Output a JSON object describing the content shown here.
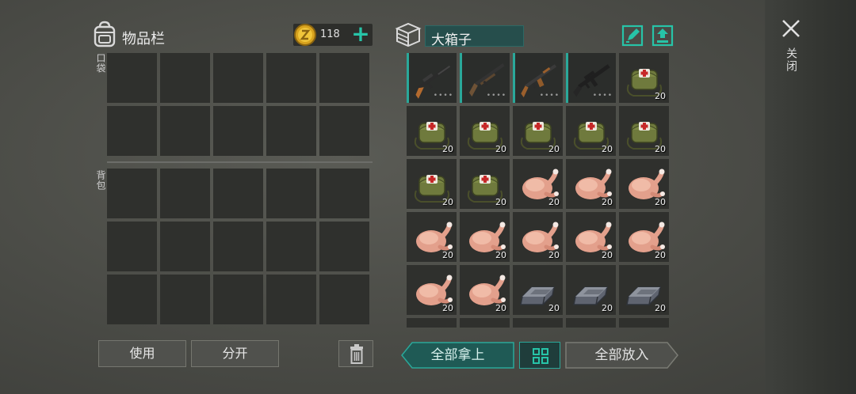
{
  "inventory": {
    "title": "物品栏",
    "coins": "118",
    "pocket_label": "口袋",
    "backpack_label": "背包",
    "icons": {
      "bag": "backpack-icon",
      "coin": "coin-icon",
      "add": "plus-icon",
      "trash": "trash-icon"
    }
  },
  "actions": {
    "use_label": "使用",
    "split_label": "分开"
  },
  "container": {
    "name": "大箱子",
    "take_all_label": "全部拿上",
    "put_all_label": "全部放入",
    "icons": {
      "box": "box-icon",
      "rename": "edit-icon",
      "sort": "sort-up-icon",
      "grid": "grid-icon"
    },
    "items": [
      {
        "type": "sniper-rifle",
        "weapon": true,
        "qty": ""
      },
      {
        "type": "shotgun",
        "weapon": true,
        "qty": ""
      },
      {
        "type": "ak-rifle",
        "weapon": true,
        "qty": ""
      },
      {
        "type": "m16-rifle",
        "weapon": true,
        "qty": ""
      },
      {
        "type": "medkit-bag",
        "weapon": false,
        "qty": "20"
      },
      {
        "type": "medkit-bag",
        "weapon": false,
        "qty": "20"
      },
      {
        "type": "medkit-bag",
        "weapon": false,
        "qty": "20"
      },
      {
        "type": "medkit-bag",
        "weapon": false,
        "qty": "20"
      },
      {
        "type": "medkit-bag",
        "weapon": false,
        "qty": "20"
      },
      {
        "type": "medkit-bag",
        "weapon": false,
        "qty": "20"
      },
      {
        "type": "medkit-bag",
        "weapon": false,
        "qty": "20"
      },
      {
        "type": "medkit-bag",
        "weapon": false,
        "qty": "20"
      },
      {
        "type": "roast-chicken",
        "weapon": false,
        "qty": "20"
      },
      {
        "type": "roast-chicken",
        "weapon": false,
        "qty": "20"
      },
      {
        "type": "roast-chicken",
        "weapon": false,
        "qty": "20"
      },
      {
        "type": "roast-chicken",
        "weapon": false,
        "qty": "20"
      },
      {
        "type": "roast-chicken",
        "weapon": false,
        "qty": "20"
      },
      {
        "type": "roast-chicken",
        "weapon": false,
        "qty": "20"
      },
      {
        "type": "roast-chicken",
        "weapon": false,
        "qty": "20"
      },
      {
        "type": "roast-chicken",
        "weapon": false,
        "qty": "20"
      },
      {
        "type": "roast-chicken",
        "weapon": false,
        "qty": "20"
      },
      {
        "type": "roast-chicken",
        "weapon": false,
        "qty": "20"
      },
      {
        "type": "iron-ingot",
        "weapon": false,
        "qty": "20"
      },
      {
        "type": "iron-ingot",
        "weapon": false,
        "qty": "20"
      },
      {
        "type": "iron-ingot",
        "weapon": false,
        "qty": "20"
      }
    ]
  },
  "close_label": "关闭",
  "colors": {
    "accent": "#27c4a8",
    "accent_dark": "#1f5a55",
    "slot": "#2f302d"
  }
}
